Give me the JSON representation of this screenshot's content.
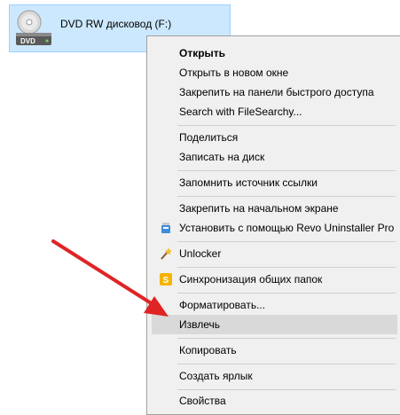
{
  "drive": {
    "label": "DVD RW дисковод (F:)",
    "icon": "dvd-drive-icon",
    "disc_badge": "DVD"
  },
  "menu": {
    "items": [
      {
        "label": "Открыть",
        "bold": true
      },
      {
        "label": "Открыть в новом окне"
      },
      {
        "label": "Закрепить на панели быстрого доступа"
      },
      {
        "label": "Search with FileSearchy..."
      },
      {
        "label": "Поделиться"
      },
      {
        "label": "Записать на диск"
      },
      {
        "label": "Запомнить источник ссылки"
      },
      {
        "label": "Закрепить на начальном экране"
      },
      {
        "label": "Установить с помощью Revo Uninstaller Pro",
        "icon": "revo-uninstaller-icon"
      },
      {
        "label": "Unlocker",
        "icon": "unlocker-wand-icon"
      },
      {
        "label": "Синхронизация общих папок",
        "icon": "sync-folders-icon"
      },
      {
        "label": "Форматировать..."
      },
      {
        "label": "Извлечь",
        "highlighted": true
      },
      {
        "label": "Копировать"
      },
      {
        "label": "Создать ярлык"
      },
      {
        "label": "Свойства"
      }
    ]
  },
  "annotation": {
    "arrow_color": "#e02424",
    "icon": "red-arrow-icon"
  }
}
